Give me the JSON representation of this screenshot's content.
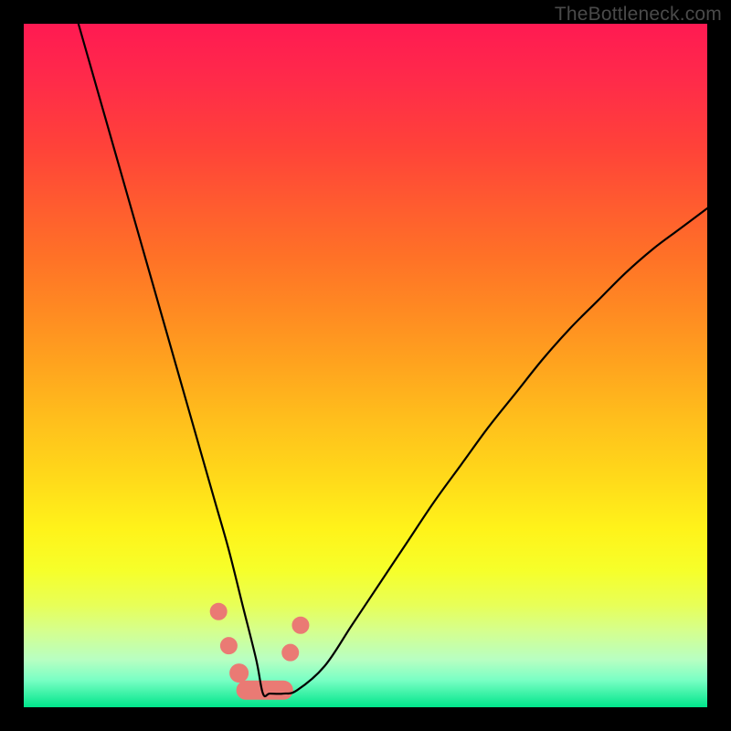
{
  "watermark": "TheBottleneck.com",
  "chart_data": {
    "type": "line",
    "title": "",
    "xlabel": "",
    "ylabel": "",
    "xlim": [
      0,
      100
    ],
    "ylim": [
      0,
      100
    ],
    "grid": false,
    "legend": false,
    "annotations": [],
    "series": [
      {
        "name": "bottleneck-curve",
        "color": "#000000",
        "x": [
          8,
          10,
          12,
          14,
          16,
          18,
          20,
          22,
          24,
          26,
          28,
          30,
          32,
          34,
          35,
          36,
          38,
          40,
          44,
          48,
          52,
          56,
          60,
          64,
          68,
          72,
          76,
          80,
          84,
          88,
          92,
          96,
          100
        ],
        "y": [
          100,
          93,
          86,
          79,
          72,
          65,
          58,
          51,
          44,
          37,
          30,
          23,
          15,
          7,
          2,
          2,
          2,
          2.5,
          6,
          12,
          18,
          24,
          30,
          35.5,
          41,
          46,
          51,
          55.5,
          59.5,
          63.5,
          67,
          70,
          73
        ]
      }
    ],
    "markers": {
      "name": "highlight-markers",
      "color": "#ea7a74",
      "points": [
        {
          "x": 28.5,
          "y": 14,
          "r": 9
        },
        {
          "x": 30.0,
          "y": 9,
          "r": 9
        },
        {
          "x": 31.5,
          "y": 5,
          "r": 10
        },
        {
          "x": 39.0,
          "y": 8,
          "r": 9
        },
        {
          "x": 40.5,
          "y": 12,
          "r": 9
        }
      ],
      "bottom_bar": {
        "x1": 32.5,
        "y": 2.5,
        "x2": 38.0
      }
    }
  }
}
